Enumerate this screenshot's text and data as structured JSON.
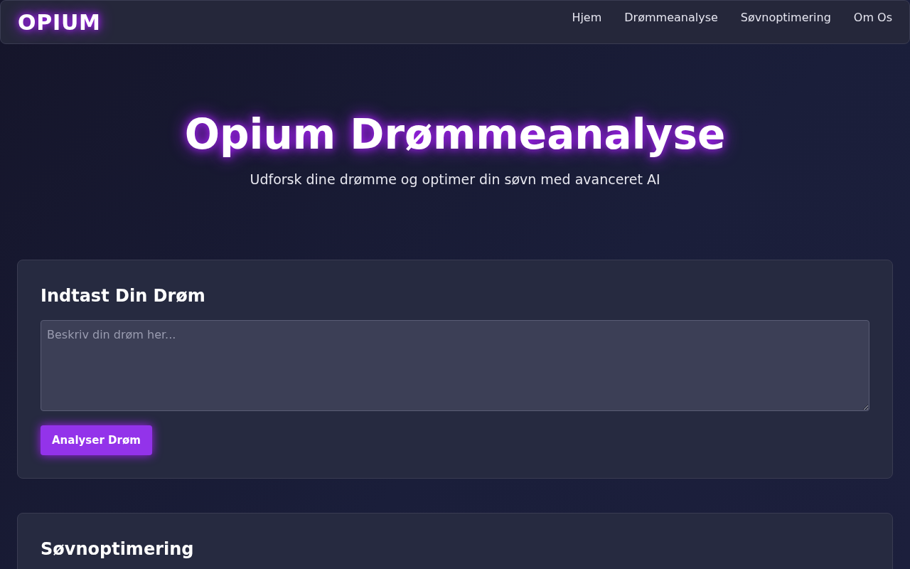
{
  "brand": "OPIUM",
  "nav": [
    {
      "label": "Hjem"
    },
    {
      "label": "Drømmeanalyse"
    },
    {
      "label": "Søvnoptimering"
    },
    {
      "label": "Om Os"
    }
  ],
  "hero": {
    "title": "Opium Drømmeanalyse",
    "subtitle": "Udforsk dine drømme og optimer din søvn med avanceret AI"
  },
  "dream_card": {
    "heading": "Indtast Din Drøm",
    "placeholder": "Beskriv din drøm her...",
    "button": "Analyser Drøm"
  },
  "sleep_card": {
    "heading": "Søvnoptimering"
  }
}
